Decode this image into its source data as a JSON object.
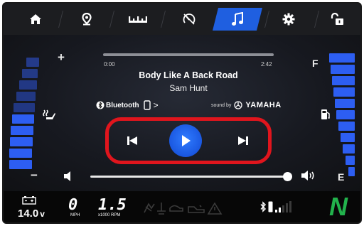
{
  "nav": {
    "tabs": [
      {
        "name": "home",
        "icon": "home-icon"
      },
      {
        "name": "navigation",
        "icon": "map-pin-icon"
      },
      {
        "name": "ruler",
        "icon": "ruler-icon"
      },
      {
        "name": "tachometer",
        "icon": "tachometer-icon"
      },
      {
        "name": "music",
        "icon": "music-note-icon",
        "active": true
      },
      {
        "name": "settings",
        "icon": "gear-icon"
      },
      {
        "name": "lock",
        "icon": "unlock-icon"
      }
    ],
    "active_color": "#1f5fe0"
  },
  "left_panel": {
    "plus_label": "+",
    "minus_label": "−",
    "icon": "seat-heat-icon"
  },
  "right_panel": {
    "full_label": "F",
    "empty_label": "E",
    "icon": "fuel-pump-icon"
  },
  "player": {
    "elapsed": "0:00",
    "duration": "2:42",
    "progress": 0.0,
    "title": "Body Like A Back Road",
    "artist": "Sam Hunt",
    "source_label": "Bluetooth",
    "source_chevron": ">",
    "sound_by_label": "sound by",
    "brand": "YAMAHA",
    "volume": 1.0
  },
  "status_bar": {
    "voltage": "14.0",
    "voltage_unit": "v",
    "speed": "0",
    "speed_unit": "MPH",
    "rpm": "1.5",
    "rpm_unit": "x1000 RPM",
    "gear": "N",
    "gear_color": "#22b24c"
  },
  "colors": {
    "accent_blue": "#1f5fe0",
    "highlight_red": "#e0151d",
    "gauge_blue": "#2d5ef2"
  }
}
